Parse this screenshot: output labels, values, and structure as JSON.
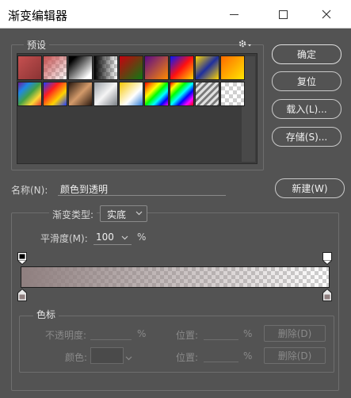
{
  "window": {
    "title": "渐变编辑器"
  },
  "presets": {
    "legend": "预设",
    "swatches": [
      "linear-gradient(135deg,#c65050,#8a3434)",
      "linear-gradient(135deg,#c65050 0%,rgba(198,80,80,0) 100%)",
      "linear-gradient(135deg,#000 15%,#fff 85%)",
      "linear-gradient(90deg,#000,transparent)",
      "linear-gradient(135deg,#c8000f,#0d7a13)",
      "linear-gradient(135deg,#5a0a8a,#ff8a00)",
      "linear-gradient(135deg,#0018ff,#ff1010,#ffd700)",
      "linear-gradient(135deg,#ffd700,#1f2f9e,#ffd700)",
      "linear-gradient(135deg,#ff6b00,#ffe600)",
      "linear-gradient(135deg,#6a1b9a,#1e88e5,#43a047,#fdd835,#e53935)",
      "linear-gradient(135deg,#1e3cff,#ff1e1e,#ffd200,#1e3cff)",
      "linear-gradient(135deg,#2b1a10,#d39a6a,#2b1a10)",
      "linear-gradient(135deg,#9aa0a6,#f5f5f5,#7a7f85)",
      "linear-gradient(135deg,#f7c600,#ffffff 60%,#2a7bd6)",
      "linear-gradient(135deg,#ff0000,#ff8800,#ffff00,#00ff00,#00ffff,#0000ff,#ff00ff)",
      "linear-gradient(135deg,#ff0000,#ffff00,#00ff00,#00ffff,#0000ff,#ff00ff,#ff0000)",
      "repeating-linear-gradient(135deg,#e0e0e0 0 3px,#7a7a7a 3px 6px)",
      "checker"
    ]
  },
  "buttons": {
    "ok": "确定",
    "reset": "复位",
    "load": "载入(L)...",
    "save": "存储(S)...",
    "new": "新建(W)"
  },
  "name": {
    "label": "名称(N):",
    "value": "颜色到透明"
  },
  "gradient": {
    "type_label": "渐变类型:",
    "type_value": "实底",
    "smooth_label": "平滑度(M):",
    "smooth_value": "100",
    "smooth_unit": "%",
    "start_color": "#8f7f7f",
    "end_color": "#ffffff"
  },
  "stops": {
    "legend": "色标",
    "opacity_label": "不透明度:",
    "opacity_unit": "%",
    "position_label_1": "位置:",
    "position_unit_1": "%",
    "delete_1": "删除(D)",
    "color_label": "颜色:",
    "position_label_2": "位置:",
    "position_unit_2": "%",
    "delete_2": "删除(D)"
  },
  "icons": {
    "gear": "gear-icon",
    "dropdown": "chevron-down-icon",
    "close": "close-icon"
  }
}
